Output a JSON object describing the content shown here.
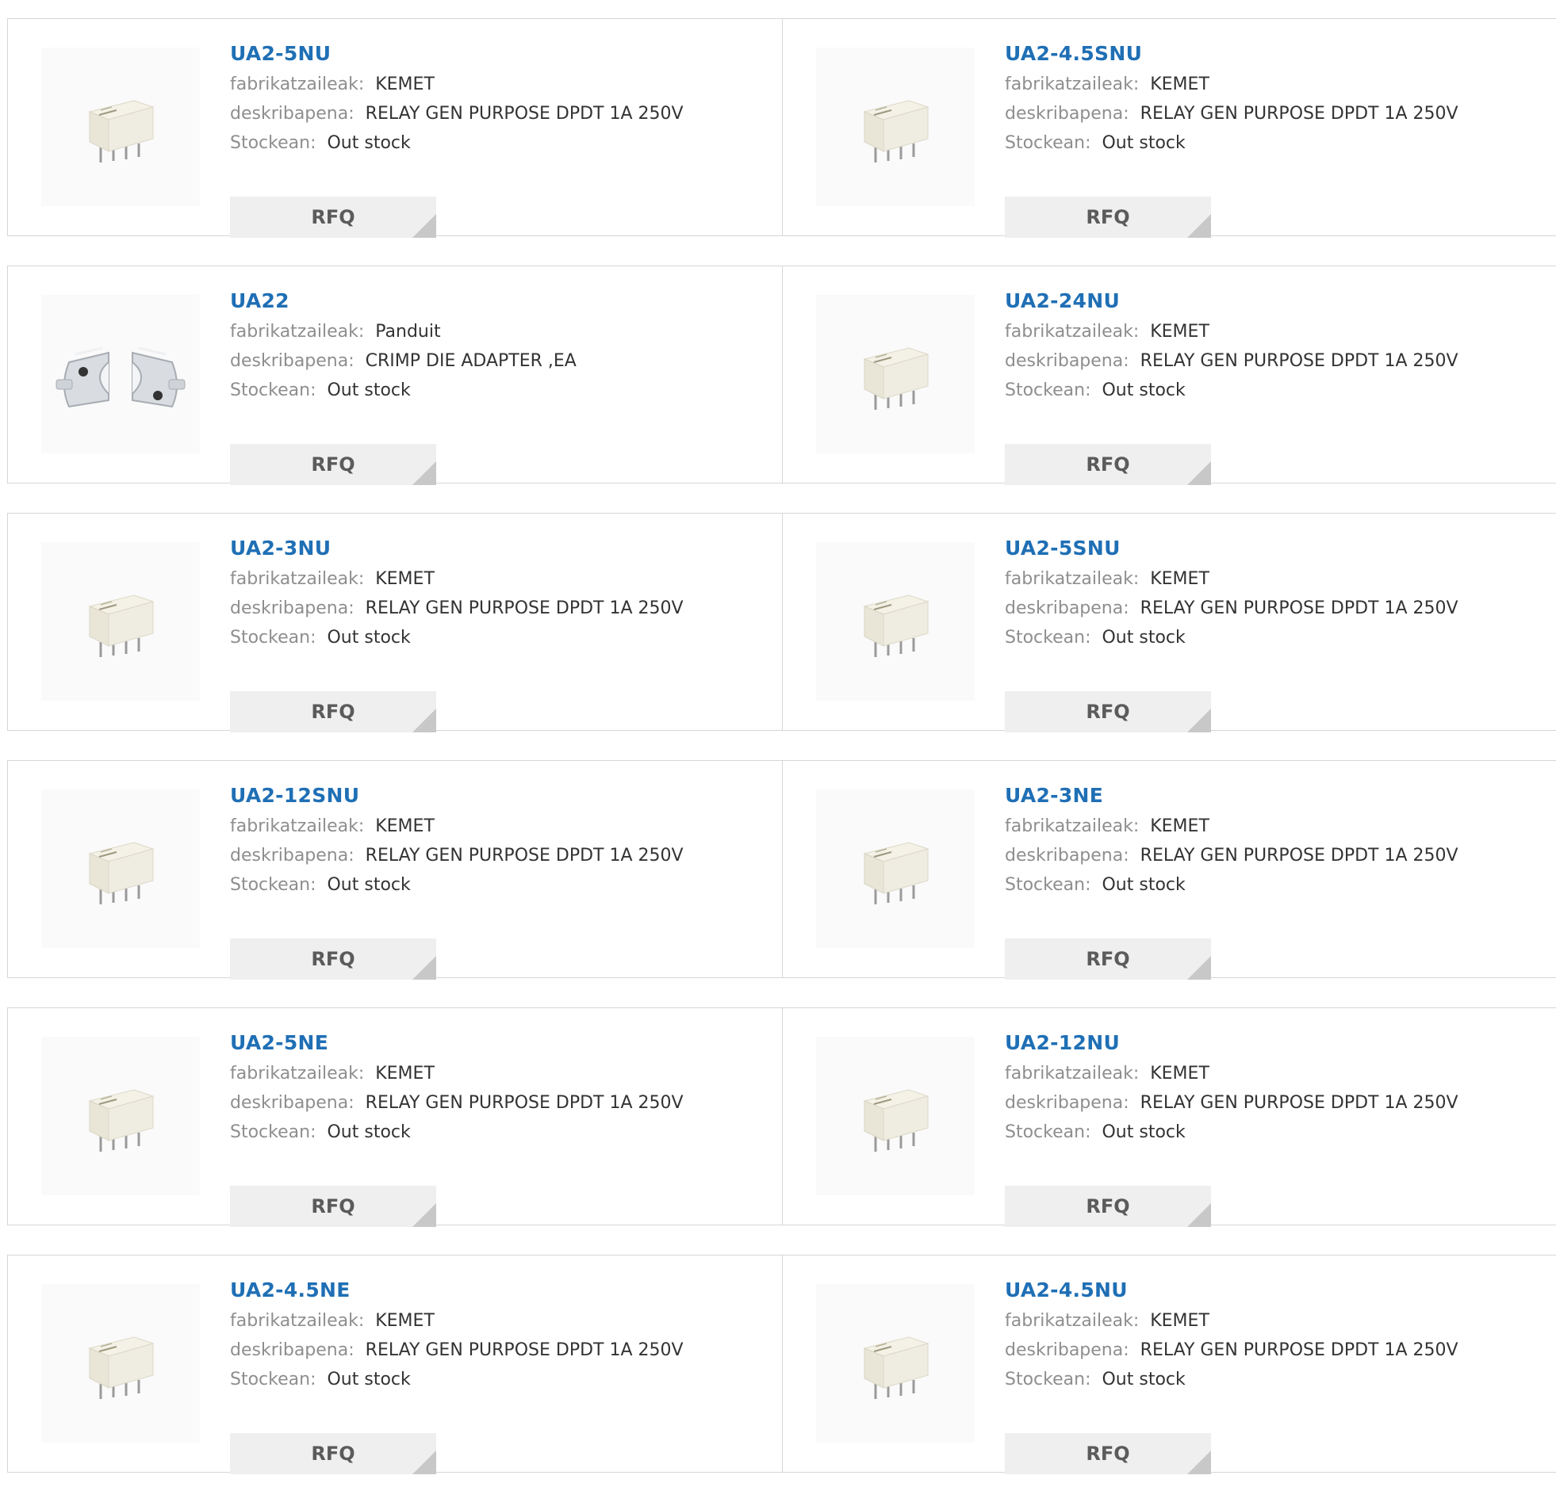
{
  "labels": {
    "manufacturer": "fabrikatzaileak:",
    "description": "deskribapena:",
    "stock": "Stockean:",
    "rfq": "RFQ"
  },
  "colors": {
    "title": "#1f6fb5",
    "label": "#8e8e8e",
    "value": "#333333",
    "button_bg": "#efefef",
    "border": "#d6d6d6"
  },
  "products": [
    {
      "part": "UA2-5NU",
      "manufacturer": "KEMET",
      "description": "RELAY GEN PURPOSE DPDT 1A 250V",
      "stock": "Out stock",
      "image": "relay-image"
    },
    {
      "part": "UA2-4.5SNU",
      "manufacturer": "KEMET",
      "description": "RELAY GEN PURPOSE DPDT 1A 250V",
      "stock": "Out stock",
      "image": "relay-image"
    },
    {
      "part": "UA22",
      "manufacturer": "Panduit",
      "description": "CRIMP DIE ADAPTER ,EA",
      "stock": "Out stock",
      "image": "crimp-die-adapter-image"
    },
    {
      "part": "UA2-24NU",
      "manufacturer": "KEMET",
      "description": "RELAY GEN PURPOSE DPDT 1A 250V",
      "stock": "Out stock",
      "image": "relay-image"
    },
    {
      "part": "UA2-3NU",
      "manufacturer": "KEMET",
      "description": "RELAY GEN PURPOSE DPDT 1A 250V",
      "stock": "Out stock",
      "image": "relay-image"
    },
    {
      "part": "UA2-5SNU",
      "manufacturer": "KEMET",
      "description": "RELAY GEN PURPOSE DPDT 1A 250V",
      "stock": "Out stock",
      "image": "relay-image"
    },
    {
      "part": "UA2-12SNU",
      "manufacturer": "KEMET",
      "description": "RELAY GEN PURPOSE DPDT 1A 250V",
      "stock": "Out stock",
      "image": "relay-image"
    },
    {
      "part": "UA2-3NE",
      "manufacturer": "KEMET",
      "description": "RELAY GEN PURPOSE DPDT 1A 250V",
      "stock": "Out stock",
      "image": "relay-image"
    },
    {
      "part": "UA2-5NE",
      "manufacturer": "KEMET",
      "description": "RELAY GEN PURPOSE DPDT 1A 250V",
      "stock": "Out stock",
      "image": "relay-image"
    },
    {
      "part": "UA2-12NU",
      "manufacturer": "KEMET",
      "description": "RELAY GEN PURPOSE DPDT 1A 250V",
      "stock": "Out stock",
      "image": "relay-image"
    },
    {
      "part": "UA2-4.5NE",
      "manufacturer": "KEMET",
      "description": "RELAY GEN PURPOSE DPDT 1A 250V",
      "stock": "Out stock",
      "image": "relay-image"
    },
    {
      "part": "UA2-4.5NU",
      "manufacturer": "KEMET",
      "description": "RELAY GEN PURPOSE DPDT 1A 250V",
      "stock": "Out stock",
      "image": "relay-image"
    }
  ]
}
